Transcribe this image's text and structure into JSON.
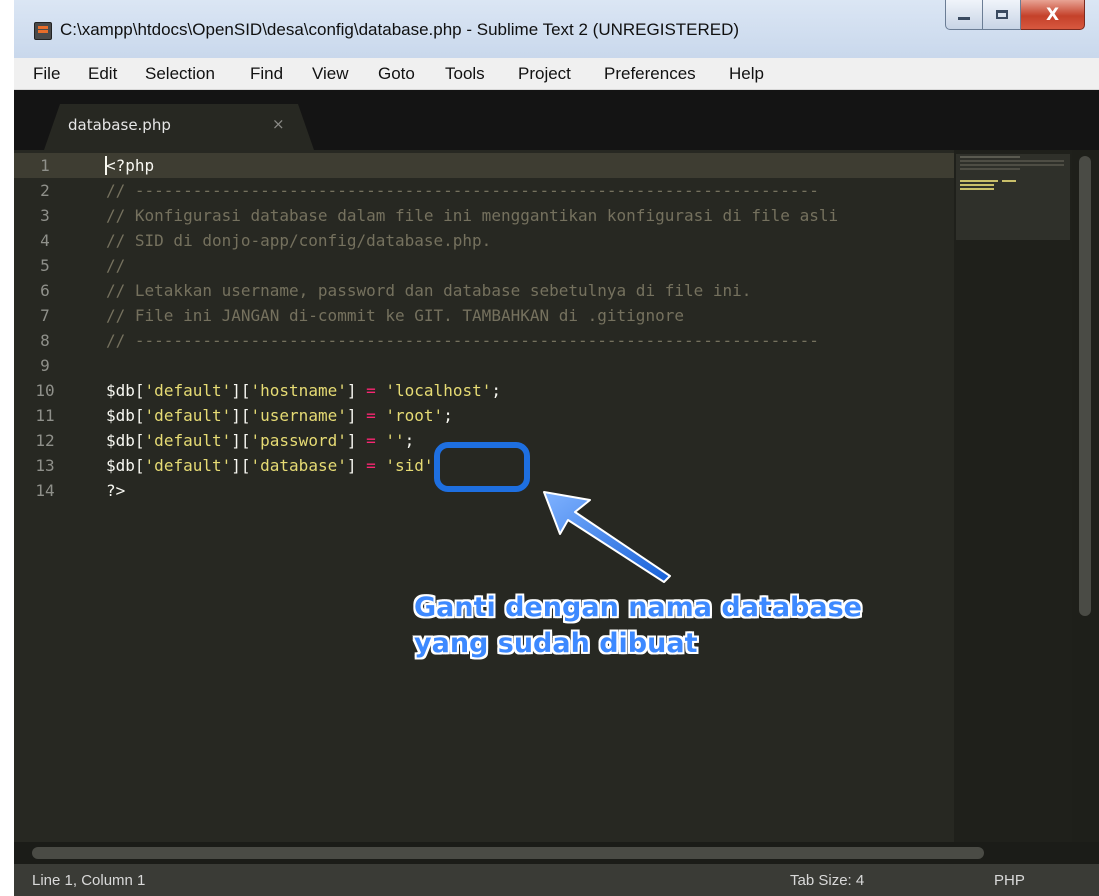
{
  "window": {
    "title": "C:\\xampp\\htdocs\\OpenSID\\desa\\config\\database.php - Sublime Text 2 (UNREGISTERED)",
    "close_glyph": "X"
  },
  "menu": [
    "File",
    "Edit",
    "Selection",
    "Find",
    "View",
    "Goto",
    "Tools",
    "Project",
    "Preferences",
    "Help"
  ],
  "tab": {
    "label": "database.php",
    "close_glyph": "×"
  },
  "editor": {
    "lines": [
      [
        {
          "t": "<?php",
          "c": "punc"
        }
      ],
      [
        {
          "t": "// -----------------------------------------------------------------------",
          "c": "comment"
        }
      ],
      [
        {
          "t": "// Konfigurasi database dalam file ini menggantikan konfigurasi di file asli",
          "c": "comment"
        }
      ],
      [
        {
          "t": "// SID di donjo-app/config/database.php.",
          "c": "comment"
        }
      ],
      [
        {
          "t": "//",
          "c": "comment"
        }
      ],
      [
        {
          "t": "// Letakkan username, password dan database sebetulnya di file ini.",
          "c": "comment"
        }
      ],
      [
        {
          "t": "// File ini JANGAN di-commit ke GIT. TAMBAHKAN di .gitignore",
          "c": "comment"
        }
      ],
      [
        {
          "t": "// -----------------------------------------------------------------------",
          "c": "comment"
        }
      ],
      [],
      [
        {
          "t": "$db",
          "c": "var"
        },
        {
          "t": "[",
          "c": "punc"
        },
        {
          "t": "'default'",
          "c": "str"
        },
        {
          "t": "][",
          "c": "punc"
        },
        {
          "t": "'hostname'",
          "c": "str"
        },
        {
          "t": "] ",
          "c": "punc"
        },
        {
          "t": "=",
          "c": "op"
        },
        {
          "t": " ",
          "c": "punc"
        },
        {
          "t": "'localhost'",
          "c": "str"
        },
        {
          "t": ";",
          "c": "punc"
        }
      ],
      [
        {
          "t": "$db",
          "c": "var"
        },
        {
          "t": "[",
          "c": "punc"
        },
        {
          "t": "'default'",
          "c": "str"
        },
        {
          "t": "][",
          "c": "punc"
        },
        {
          "t": "'username'",
          "c": "str"
        },
        {
          "t": "] ",
          "c": "punc"
        },
        {
          "t": "=",
          "c": "op"
        },
        {
          "t": " ",
          "c": "punc"
        },
        {
          "t": "'root'",
          "c": "str"
        },
        {
          "t": ";",
          "c": "punc"
        }
      ],
      [
        {
          "t": "$db",
          "c": "var"
        },
        {
          "t": "[",
          "c": "punc"
        },
        {
          "t": "'default'",
          "c": "str"
        },
        {
          "t": "][",
          "c": "punc"
        },
        {
          "t": "'password'",
          "c": "str"
        },
        {
          "t": "] ",
          "c": "punc"
        },
        {
          "t": "=",
          "c": "op"
        },
        {
          "t": " ",
          "c": "punc"
        },
        {
          "t": "''",
          "c": "str"
        },
        {
          "t": ";",
          "c": "punc"
        }
      ],
      [
        {
          "t": "$db",
          "c": "var"
        },
        {
          "t": "[",
          "c": "punc"
        },
        {
          "t": "'default'",
          "c": "str"
        },
        {
          "t": "][",
          "c": "punc"
        },
        {
          "t": "'database'",
          "c": "str"
        },
        {
          "t": "] ",
          "c": "punc"
        },
        {
          "t": "=",
          "c": "op"
        },
        {
          "t": " ",
          "c": "punc"
        },
        {
          "t": "'sid'",
          "c": "str"
        },
        {
          "t": ";",
          "c": "punc"
        }
      ],
      [
        {
          "t": "?>",
          "c": "punc"
        }
      ]
    ]
  },
  "status": {
    "position": "Line 1, Column 1",
    "tab_size": "Tab Size: 4",
    "syntax": "PHP"
  },
  "annotation": {
    "line1": "Ganti dengan nama database",
    "line2": "yang sudah dibuat"
  },
  "colors": {
    "accent_blue": "#1e6fe0",
    "editor_bg": "#272822",
    "comment": "#75715e",
    "string": "#e6db74",
    "operator": "#f92672"
  }
}
